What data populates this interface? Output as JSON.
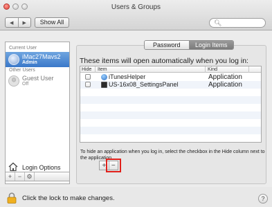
{
  "window": {
    "title": "Users & Groups"
  },
  "toolbar": {
    "back": "◀",
    "forward": "▶",
    "show_all": "Show All",
    "search_placeholder": ""
  },
  "sidebar": {
    "current_user_header": "Current User",
    "current_user": {
      "name": "iMac27Mavs2",
      "role": "Admin"
    },
    "other_users_header": "Other Users",
    "guest_user": {
      "name": "Guest User",
      "status": "Off"
    },
    "login_options": "Login Options",
    "footer": {
      "add": "+",
      "remove": "−",
      "settings": "⚙"
    }
  },
  "tabs": [
    {
      "label": "Password",
      "selected": false
    },
    {
      "label": "Login Items",
      "selected": true
    }
  ],
  "login_items": {
    "intro": "These items will open automatically when you log in:",
    "columns": {
      "hide": "Hide",
      "item": "Item",
      "kind": "Kind"
    },
    "rows": [
      {
        "hide": false,
        "item": "iTunesHelper",
        "kind": "Application",
        "icon": "itunes-icon"
      },
      {
        "hide": false,
        "item": "US-16x08_SettingsPanel",
        "kind": "Application",
        "icon": "settings-panel-icon"
      }
    ],
    "note": "To hide an application when you log in, select the checkbox in the Hide column next to the application.",
    "add": "+",
    "remove": "−"
  },
  "bottom": {
    "lock_text": "Click the lock to make changes.",
    "help": "?"
  },
  "colors": {
    "selection": "#3a78c9",
    "highlight_box": "#e0201a",
    "lock": "#f0b020"
  }
}
